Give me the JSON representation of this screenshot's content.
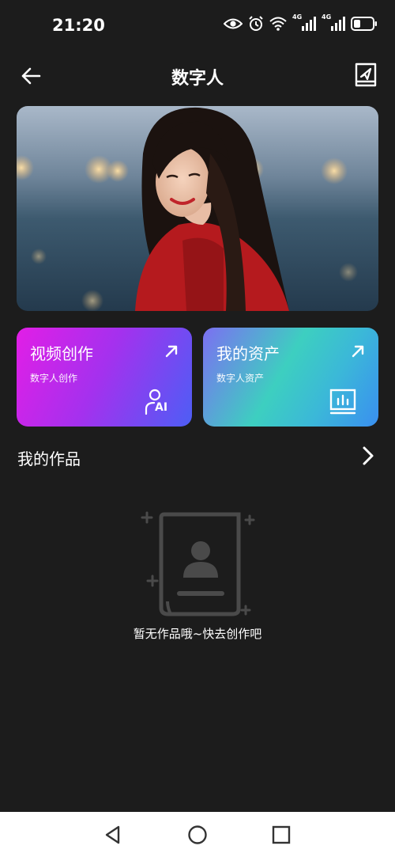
{
  "status_bar": {
    "time": "21:20",
    "signal_badge_1": "4G",
    "signal_badge_2": "4G",
    "icons": [
      "eye-icon",
      "alarm-icon",
      "wifi-icon",
      "signal-icon",
      "signal-icon",
      "battery-icon"
    ]
  },
  "header": {
    "title": "数字人",
    "back_icon": "arrow-left-icon",
    "action_icon": "send-card-icon"
  },
  "cards": [
    {
      "title": "视频创作",
      "subtitle": "数字人创作",
      "arrow_icon": "arrow-up-right-icon",
      "deco_icon": "person-ai-icon",
      "deco_text": "AI"
    },
    {
      "title": "我的资产",
      "subtitle": "数字人资产",
      "arrow_icon": "arrow-up-right-icon",
      "deco_icon": "chart-board-icon"
    }
  ],
  "works": {
    "title": "我的作品",
    "more_icon": "chevron-right-icon",
    "empty_text": "暂无作品哦~快去创作吧",
    "empty_icon": "profile-card-icon"
  },
  "nav_bar": {
    "icons": [
      "back-triangle-icon",
      "home-circle-icon",
      "recents-square-icon"
    ]
  },
  "colors": {
    "background": "#1c1c1c",
    "card_video_gradient": [
      "#e21ee6",
      "#4d5ef5"
    ],
    "card_assets_gradient": [
      "#7c6ff2",
      "#3dcfc0",
      "#3a8ff0"
    ]
  }
}
